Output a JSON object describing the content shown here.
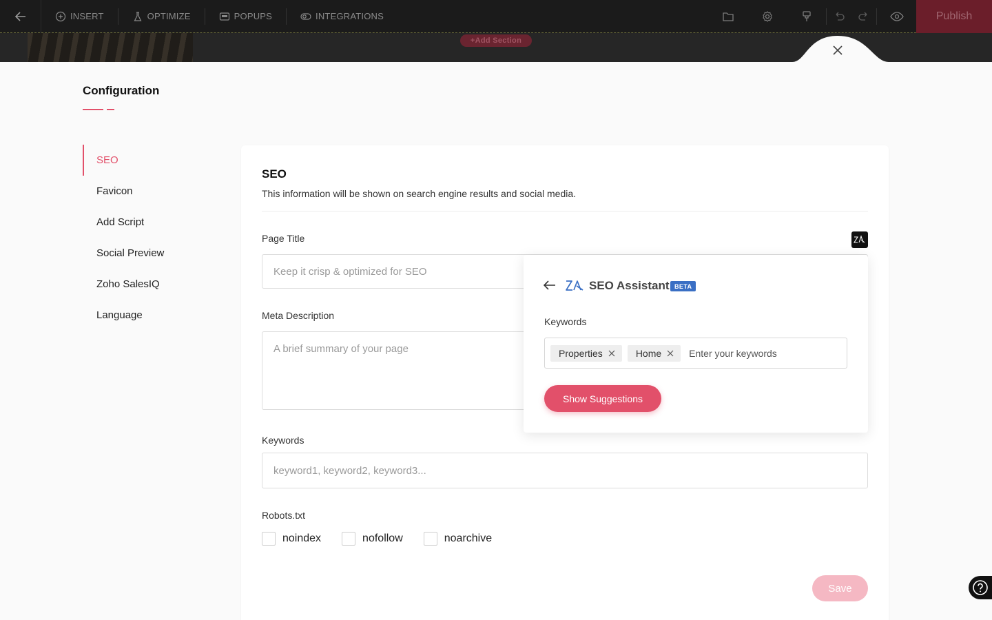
{
  "toolbar": {
    "menu": [
      {
        "label": "INSERT",
        "icon": "plus-circle-icon"
      },
      {
        "label": "OPTIMIZE",
        "icon": "flask-icon"
      },
      {
        "label": "POPUPS",
        "icon": "popup-icon"
      },
      {
        "label": "INTEGRATIONS",
        "icon": "toggle-icon"
      }
    ],
    "right_icons": [
      "folder-icon",
      "settings-icon",
      "paint-brush-icon",
      "undo-icon",
      "redo-icon",
      "preview-eye-icon"
    ],
    "publish_label": "Publish"
  },
  "canvas": {
    "add_section_label": "+Add Section"
  },
  "config": {
    "title": "Configuration",
    "accent": "#e2506a",
    "nav": [
      {
        "label": "SEO",
        "active": true
      },
      {
        "label": "Favicon",
        "active": false
      },
      {
        "label": "Add Script",
        "active": false
      },
      {
        "label": "Social Preview",
        "active": false
      },
      {
        "label": "Zoho SalesIQ",
        "active": false
      },
      {
        "label": "Language",
        "active": false
      }
    ]
  },
  "seo": {
    "title": "SEO",
    "subtitle": "This information will be shown on search engine results and social media.",
    "page_title": {
      "label": "Page Title",
      "value": "",
      "placeholder": "Keep it crisp & optimized for SEO"
    },
    "meta_description": {
      "label": "Meta Description",
      "value": "",
      "placeholder": "A brief summary of your page"
    },
    "keywords": {
      "label": "Keywords",
      "value": "",
      "placeholder": "keyword1, keyword2, keyword3..."
    },
    "robots": {
      "label": "Robots.txt",
      "options": [
        {
          "label": "noindex",
          "checked": false
        },
        {
          "label": "nofollow",
          "checked": false
        },
        {
          "label": "noarchive",
          "checked": false
        }
      ]
    },
    "save_label": "Save"
  },
  "assistant": {
    "title": "SEO Assistant",
    "badge": "BETA",
    "badge_color": "#3a6fc4",
    "keywords_label": "Keywords",
    "tags": [
      "Properties",
      "Home"
    ],
    "input_placeholder": "Enter your keywords",
    "button_label": "Show Suggestions"
  }
}
